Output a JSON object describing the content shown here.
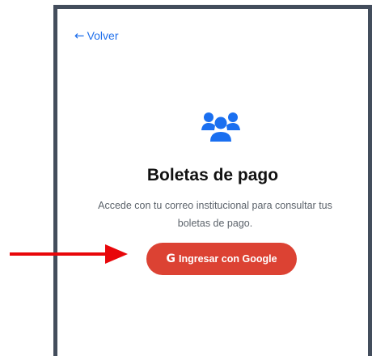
{
  "back": {
    "label": "Volver",
    "icon": "arrow-left-icon"
  },
  "login": {
    "icon": "users-icon",
    "title": "Boletas de pago",
    "description": "Accede con tu correo institucional para consultar tus boletas de pago.",
    "google_button": {
      "icon": "google-icon",
      "icon_glyph": "G",
      "label": "Ingresar con Google"
    }
  },
  "annotation": {
    "type": "red-arrow-icon",
    "color": "#e8060a"
  },
  "colors": {
    "accent": "#1f6feb",
    "icon": "#1a6ff0",
    "button": "#dc4233",
    "card_border": "#434d5c"
  }
}
